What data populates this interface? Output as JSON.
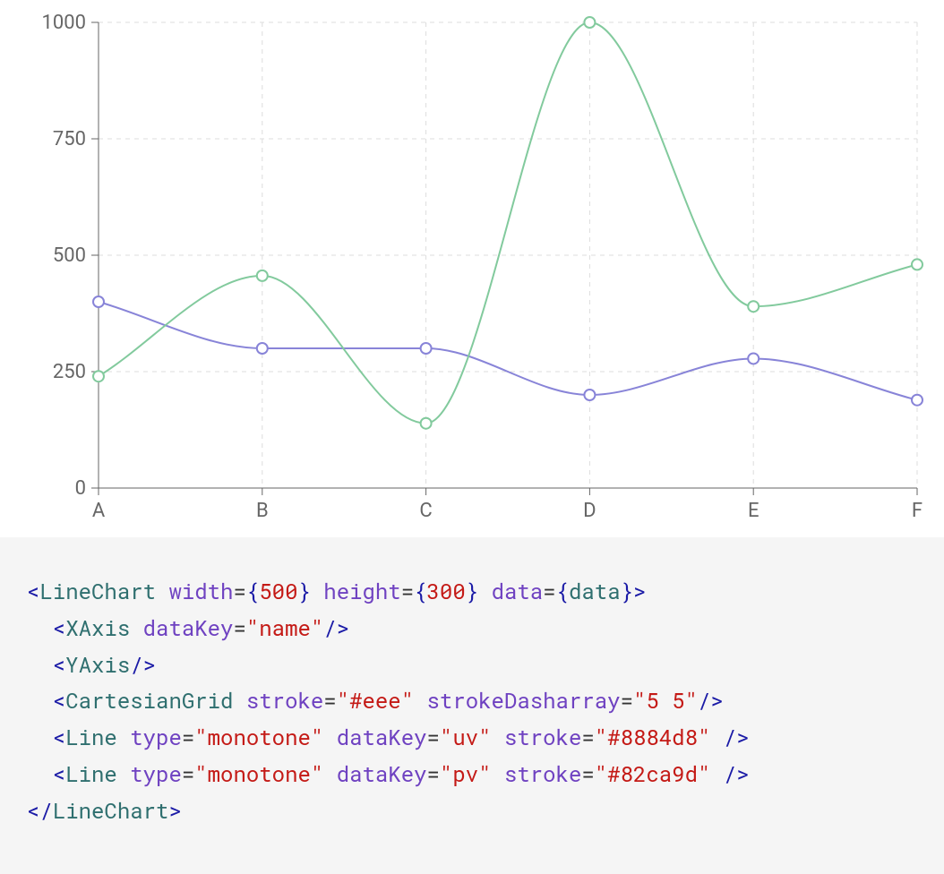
{
  "chart_data": {
    "type": "line",
    "categories": [
      "A",
      "B",
      "C",
      "D",
      "E",
      "F"
    ],
    "series": [
      {
        "name": "uv",
        "values": [
          400,
          300,
          300,
          200,
          278,
          189
        ],
        "color": "#8884d8"
      },
      {
        "name": "pv",
        "values": [
          240,
          456,
          139,
          1000,
          390,
          480
        ],
        "color": "#82ca9d"
      }
    ],
    "xlabel": "",
    "ylabel": "",
    "ylim": [
      0,
      1000
    ],
    "yticks": [
      0,
      250,
      500,
      750,
      1000
    ],
    "title": ""
  },
  "code": {
    "line1": {
      "tag": "LineChart",
      "attr_width": "width",
      "width_val": "500",
      "attr_height": "height",
      "height_val": "300",
      "attr_data": "data",
      "data_val": "data"
    },
    "line2": {
      "tag": "XAxis",
      "attr_dataKey": "dataKey",
      "dataKey_val": "\"name\""
    },
    "line3": {
      "tag": "YAxis"
    },
    "line4": {
      "tag": "CartesianGrid",
      "attr_stroke": "stroke",
      "stroke_val": "\"#eee\"",
      "attr_dash": "strokeDasharray",
      "dash_val": "\"5 5\""
    },
    "line5": {
      "tag": "Line",
      "attr_type": "type",
      "type_val": "\"monotone\"",
      "attr_dataKey": "dataKey",
      "dataKey_val": "\"uv\"",
      "attr_stroke": "stroke",
      "stroke_val": "\"#8884d8\""
    },
    "line6": {
      "tag": "Line",
      "attr_type": "type",
      "type_val": "\"monotone\"",
      "attr_dataKey": "dataKey",
      "dataKey_val": "\"pv\"",
      "attr_stroke": "stroke",
      "stroke_val": "\"#82ca9d\""
    },
    "line7": {
      "tag": "LineChart"
    }
  }
}
